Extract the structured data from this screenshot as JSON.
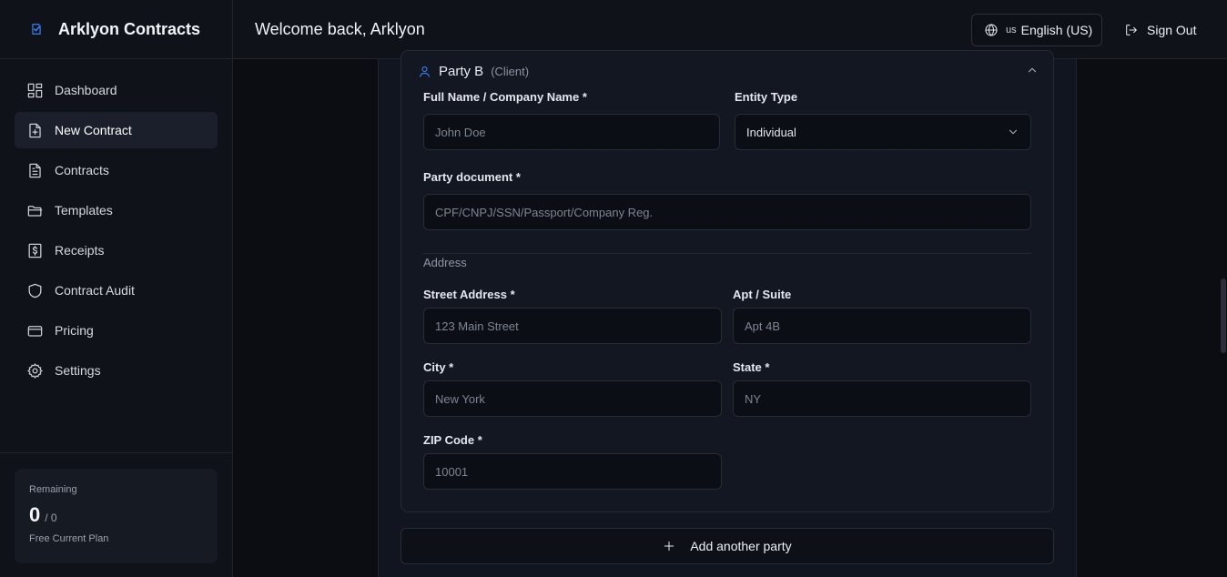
{
  "brand": {
    "name": "Arklyon Contracts"
  },
  "header": {
    "welcome": "Welcome back, Arklyon",
    "language_flag": "us",
    "language_label": "English (US)",
    "signout_label": "Sign Out"
  },
  "sidebar": {
    "items": [
      {
        "label": "Dashboard",
        "icon": "dashboard-icon"
      },
      {
        "label": "New Contract",
        "icon": "file-plus-icon",
        "active": true
      },
      {
        "label": "Contracts",
        "icon": "file-text-icon"
      },
      {
        "label": "Templates",
        "icon": "folder-icon"
      },
      {
        "label": "Receipts",
        "icon": "receipt-icon"
      },
      {
        "label": "Contract Audit",
        "icon": "shield-icon"
      },
      {
        "label": "Pricing",
        "icon": "credit-card-icon"
      },
      {
        "label": "Settings",
        "icon": "gear-icon"
      }
    ],
    "plan": {
      "remaining_label": "Remaining",
      "used": "0",
      "total": "/ 0",
      "plan_name": "Free Current Plan"
    }
  },
  "party": {
    "title": "Party B",
    "role": "(Client)",
    "name_label": "Full Name / Company Name *",
    "name_placeholder": "John Doe",
    "entity_label": "Entity Type",
    "entity_value": "Individual",
    "document_label": "Party document *",
    "document_placeholder": "CPF/CNPJ/SSN/Passport/Company Reg.",
    "address_section": "Address",
    "street_label": "Street Address *",
    "street_placeholder": "123 Main Street",
    "apt_label": "Apt / Suite",
    "apt_placeholder": "Apt 4B",
    "city_label": "City *",
    "city_placeholder": "New York",
    "state_label": "State *",
    "state_placeholder": "NY",
    "zip_label": "ZIP Code *",
    "zip_placeholder": "10001"
  },
  "actions": {
    "add_party_label": "Add another party"
  },
  "colors": {
    "accent": "#3b82f6",
    "background": "#0b0d12",
    "surface": "#111520"
  }
}
